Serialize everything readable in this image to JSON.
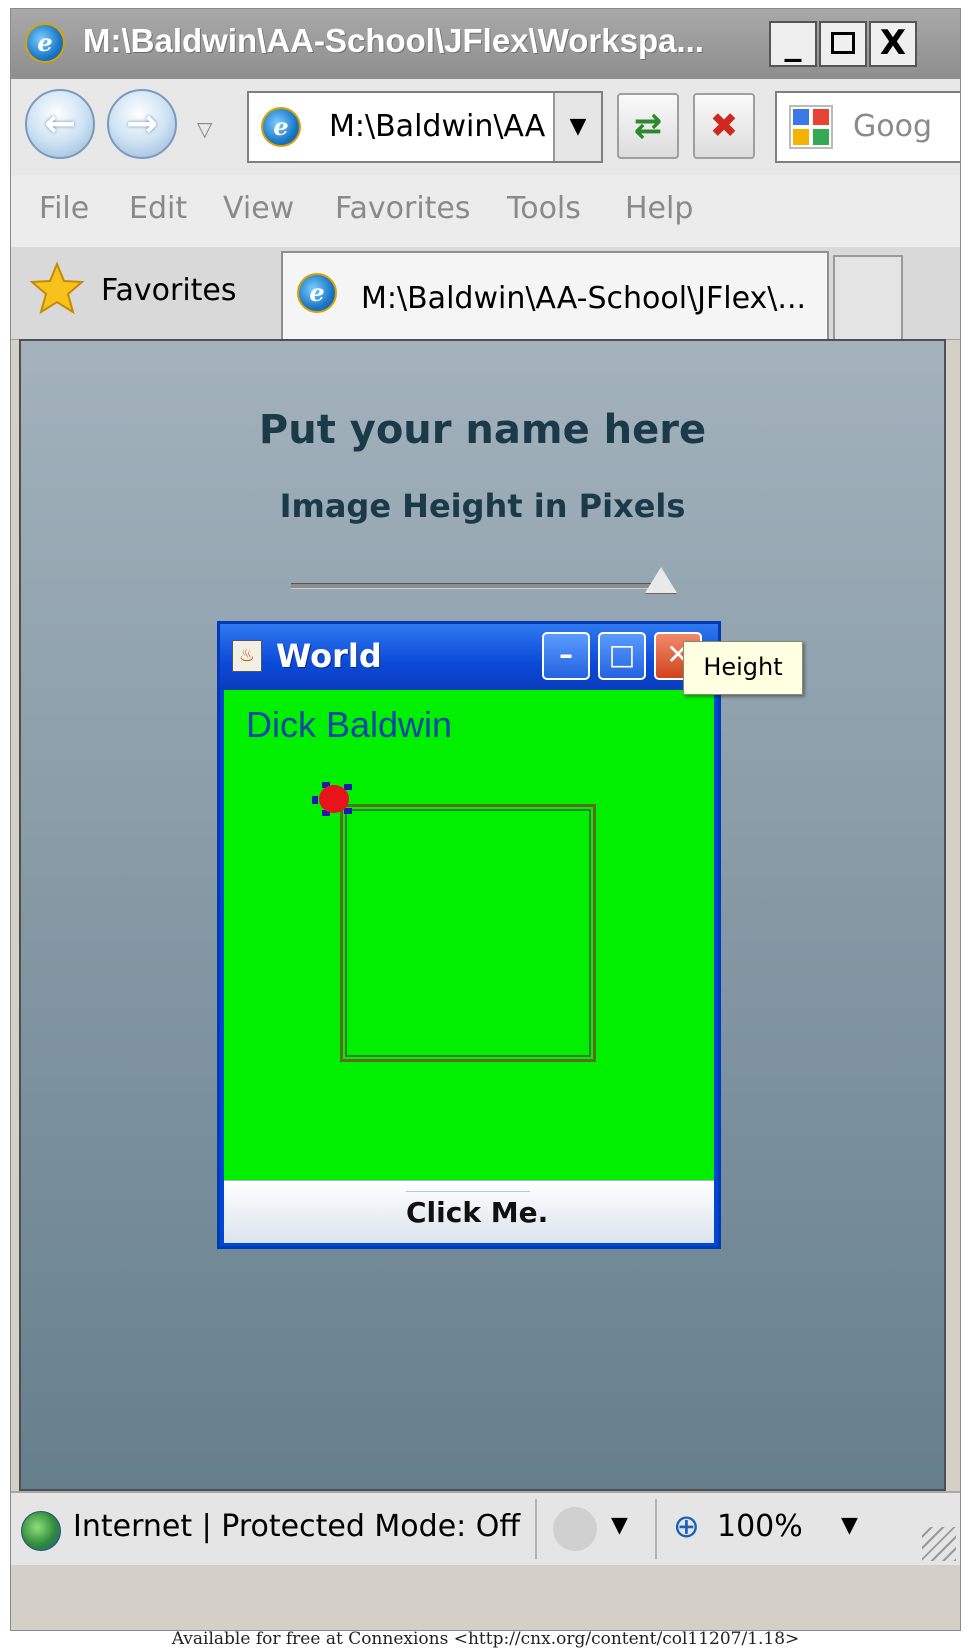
{
  "browser": {
    "title": "M:\\Baldwin\\AA-School\\JFlex\\Workspa...",
    "window_buttons": {
      "minimize": "_",
      "maximize": "□",
      "close": "X"
    },
    "address": "M:\\Baldwin\\AA",
    "search_placeholder": "Goog",
    "menu": [
      "File",
      "Edit",
      "View",
      "Favorites",
      "Tools",
      "Help"
    ],
    "favorites_label": "Favorites",
    "tab_title": "M:\\Baldwin\\AA-School\\JFlex\\..."
  },
  "page": {
    "heading": "Put your name here",
    "subheading": "Image Height in Pixels",
    "slider_value_fraction": 1.0,
    "tooltip": "Height"
  },
  "java_window": {
    "title": "World",
    "name_text": "Dick Baldwin",
    "button_label": "Click Me.",
    "body_color": "#00f000"
  },
  "status": {
    "zone_text": "Internet | Protected Mode: Off",
    "zoom": "100%"
  },
  "footer": "Available for free at Connexions <http://cnx.org/content/col11207/1.18>",
  "icons": [
    "ie-logo-icon",
    "back-icon",
    "forward-icon",
    "refresh-icon",
    "stop-icon",
    "google-icon",
    "star-icon",
    "java-icon",
    "globe-icon",
    "zoom-icon",
    "turtle-icon"
  ]
}
